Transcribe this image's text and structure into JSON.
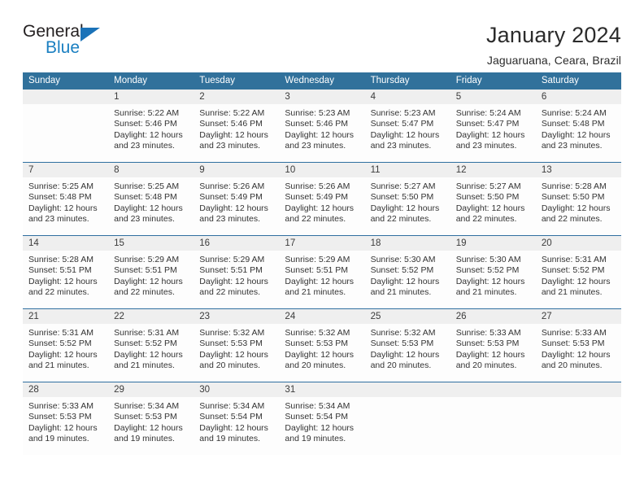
{
  "brand": {
    "word_one": "General",
    "word_two": "Blue",
    "triangle_icon": "triangle-icon",
    "accent_color": "#1a72b8"
  },
  "header": {
    "title": "January 2024",
    "subtitle": "Jaguaruana, Ceara, Brazil"
  },
  "theme": {
    "header_blue": "#31719b",
    "daynum_band": "#efefef",
    "text": "#333333"
  },
  "calendar": {
    "weekdays": [
      "Sunday",
      "Monday",
      "Tuesday",
      "Wednesday",
      "Thursday",
      "Friday",
      "Saturday"
    ],
    "weeks": [
      {
        "days": [
          {
            "num": "",
            "lines": []
          },
          {
            "num": "1",
            "lines": [
              "Sunrise: 5:22 AM",
              "Sunset: 5:46 PM",
              "Daylight: 12 hours",
              "and 23 minutes."
            ]
          },
          {
            "num": "2",
            "lines": [
              "Sunrise: 5:22 AM",
              "Sunset: 5:46 PM",
              "Daylight: 12 hours",
              "and 23 minutes."
            ]
          },
          {
            "num": "3",
            "lines": [
              "Sunrise: 5:23 AM",
              "Sunset: 5:46 PM",
              "Daylight: 12 hours",
              "and 23 minutes."
            ]
          },
          {
            "num": "4",
            "lines": [
              "Sunrise: 5:23 AM",
              "Sunset: 5:47 PM",
              "Daylight: 12 hours",
              "and 23 minutes."
            ]
          },
          {
            "num": "5",
            "lines": [
              "Sunrise: 5:24 AM",
              "Sunset: 5:47 PM",
              "Daylight: 12 hours",
              "and 23 minutes."
            ]
          },
          {
            "num": "6",
            "lines": [
              "Sunrise: 5:24 AM",
              "Sunset: 5:48 PM",
              "Daylight: 12 hours",
              "and 23 minutes."
            ]
          }
        ]
      },
      {
        "days": [
          {
            "num": "7",
            "lines": [
              "Sunrise: 5:25 AM",
              "Sunset: 5:48 PM",
              "Daylight: 12 hours",
              "and 23 minutes."
            ]
          },
          {
            "num": "8",
            "lines": [
              "Sunrise: 5:25 AM",
              "Sunset: 5:48 PM",
              "Daylight: 12 hours",
              "and 23 minutes."
            ]
          },
          {
            "num": "9",
            "lines": [
              "Sunrise: 5:26 AM",
              "Sunset: 5:49 PM",
              "Daylight: 12 hours",
              "and 23 minutes."
            ]
          },
          {
            "num": "10",
            "lines": [
              "Sunrise: 5:26 AM",
              "Sunset: 5:49 PM",
              "Daylight: 12 hours",
              "and 22 minutes."
            ]
          },
          {
            "num": "11",
            "lines": [
              "Sunrise: 5:27 AM",
              "Sunset: 5:50 PM",
              "Daylight: 12 hours",
              "and 22 minutes."
            ]
          },
          {
            "num": "12",
            "lines": [
              "Sunrise: 5:27 AM",
              "Sunset: 5:50 PM",
              "Daylight: 12 hours",
              "and 22 minutes."
            ]
          },
          {
            "num": "13",
            "lines": [
              "Sunrise: 5:28 AM",
              "Sunset: 5:50 PM",
              "Daylight: 12 hours",
              "and 22 minutes."
            ]
          }
        ]
      },
      {
        "days": [
          {
            "num": "14",
            "lines": [
              "Sunrise: 5:28 AM",
              "Sunset: 5:51 PM",
              "Daylight: 12 hours",
              "and 22 minutes."
            ]
          },
          {
            "num": "15",
            "lines": [
              "Sunrise: 5:29 AM",
              "Sunset: 5:51 PM",
              "Daylight: 12 hours",
              "and 22 minutes."
            ]
          },
          {
            "num": "16",
            "lines": [
              "Sunrise: 5:29 AM",
              "Sunset: 5:51 PM",
              "Daylight: 12 hours",
              "and 22 minutes."
            ]
          },
          {
            "num": "17",
            "lines": [
              "Sunrise: 5:29 AM",
              "Sunset: 5:51 PM",
              "Daylight: 12 hours",
              "and 21 minutes."
            ]
          },
          {
            "num": "18",
            "lines": [
              "Sunrise: 5:30 AM",
              "Sunset: 5:52 PM",
              "Daylight: 12 hours",
              "and 21 minutes."
            ]
          },
          {
            "num": "19",
            "lines": [
              "Sunrise: 5:30 AM",
              "Sunset: 5:52 PM",
              "Daylight: 12 hours",
              "and 21 minutes."
            ]
          },
          {
            "num": "20",
            "lines": [
              "Sunrise: 5:31 AM",
              "Sunset: 5:52 PM",
              "Daylight: 12 hours",
              "and 21 minutes."
            ]
          }
        ]
      },
      {
        "days": [
          {
            "num": "21",
            "lines": [
              "Sunrise: 5:31 AM",
              "Sunset: 5:52 PM",
              "Daylight: 12 hours",
              "and 21 minutes."
            ]
          },
          {
            "num": "22",
            "lines": [
              "Sunrise: 5:31 AM",
              "Sunset: 5:52 PM",
              "Daylight: 12 hours",
              "and 21 minutes."
            ]
          },
          {
            "num": "23",
            "lines": [
              "Sunrise: 5:32 AM",
              "Sunset: 5:53 PM",
              "Daylight: 12 hours",
              "and 20 minutes."
            ]
          },
          {
            "num": "24",
            "lines": [
              "Sunrise: 5:32 AM",
              "Sunset: 5:53 PM",
              "Daylight: 12 hours",
              "and 20 minutes."
            ]
          },
          {
            "num": "25",
            "lines": [
              "Sunrise: 5:32 AM",
              "Sunset: 5:53 PM",
              "Daylight: 12 hours",
              "and 20 minutes."
            ]
          },
          {
            "num": "26",
            "lines": [
              "Sunrise: 5:33 AM",
              "Sunset: 5:53 PM",
              "Daylight: 12 hours",
              "and 20 minutes."
            ]
          },
          {
            "num": "27",
            "lines": [
              "Sunrise: 5:33 AM",
              "Sunset: 5:53 PM",
              "Daylight: 12 hours",
              "and 20 minutes."
            ]
          }
        ]
      },
      {
        "days": [
          {
            "num": "28",
            "lines": [
              "Sunrise: 5:33 AM",
              "Sunset: 5:53 PM",
              "Daylight: 12 hours",
              "and 19 minutes."
            ]
          },
          {
            "num": "29",
            "lines": [
              "Sunrise: 5:34 AM",
              "Sunset: 5:53 PM",
              "Daylight: 12 hours",
              "and 19 minutes."
            ]
          },
          {
            "num": "30",
            "lines": [
              "Sunrise: 5:34 AM",
              "Sunset: 5:54 PM",
              "Daylight: 12 hours",
              "and 19 minutes."
            ]
          },
          {
            "num": "31",
            "lines": [
              "Sunrise: 5:34 AM",
              "Sunset: 5:54 PM",
              "Daylight: 12 hours",
              "and 19 minutes."
            ]
          },
          {
            "num": "",
            "lines": []
          },
          {
            "num": "",
            "lines": []
          },
          {
            "num": "",
            "lines": []
          }
        ]
      }
    ]
  }
}
